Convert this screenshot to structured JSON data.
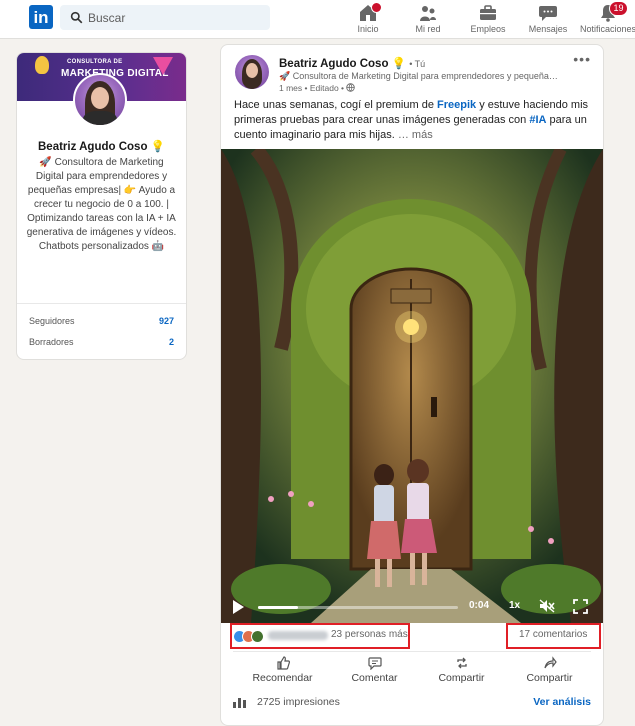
{
  "header": {
    "logo": "in",
    "search_placeholder": "Buscar",
    "nav": [
      {
        "label": "Inicio",
        "icon": "home-icon"
      },
      {
        "label": "Mi red",
        "icon": "network-icon"
      },
      {
        "label": "Empleos",
        "icon": "briefcase-icon"
      },
      {
        "label": "Mensajes",
        "icon": "messaging-icon"
      },
      {
        "label": "Notificaciones",
        "icon": "bell-icon",
        "badge": "19"
      }
    ]
  },
  "profile": {
    "banner_line1": "CONSULTORA DE",
    "banner_line2": "MARKETING DIGITAL",
    "name": "Beatriz Agudo Coso 💡",
    "headline": "🚀 Consultora de Marketing Digital para emprendedores y pequeñas empresas| 👉 Ayudo a crecer tu negocio de 0 a 100. | Optimizando tareas con la IA + IA generativa de imágenes y vídeos. Chatbots personalizados 🤖",
    "stats": [
      {
        "label": "Seguidores",
        "value": "927"
      },
      {
        "label": "Borradores",
        "value": "2"
      }
    ]
  },
  "post": {
    "author": "Beatriz Agudo Coso 💡",
    "author_suffix": "• Tú",
    "headline": "🚀 Consultora de Marketing Digital para emprendedores y pequeña…",
    "meta": "1 mes • Editado •",
    "text_part1": "Hace unas semanas, cogí el premium de ",
    "text_link1": "Freepik",
    "text_part2": " y estuve haciendo mis primeras pruebas para crear unas imágenes generadas con ",
    "text_link2": "#IA",
    "text_part3": " para un cuento imaginario para mis hijas.",
    "text_more": "… más",
    "video": {
      "time": "0:04",
      "speed": "1x",
      "progress": 0.2
    },
    "reactions_text": "23 personas más",
    "comments_text": "17 comentarios",
    "actions": [
      "Recomendar",
      "Comentar",
      "Compartir",
      "Compartir"
    ],
    "impressions": "2725 impresiones",
    "analytics_link": "Ver análisis"
  },
  "colors": {
    "brand": "#0a66c2",
    "highlight": "#e01f26",
    "badge": "#cb112d"
  }
}
